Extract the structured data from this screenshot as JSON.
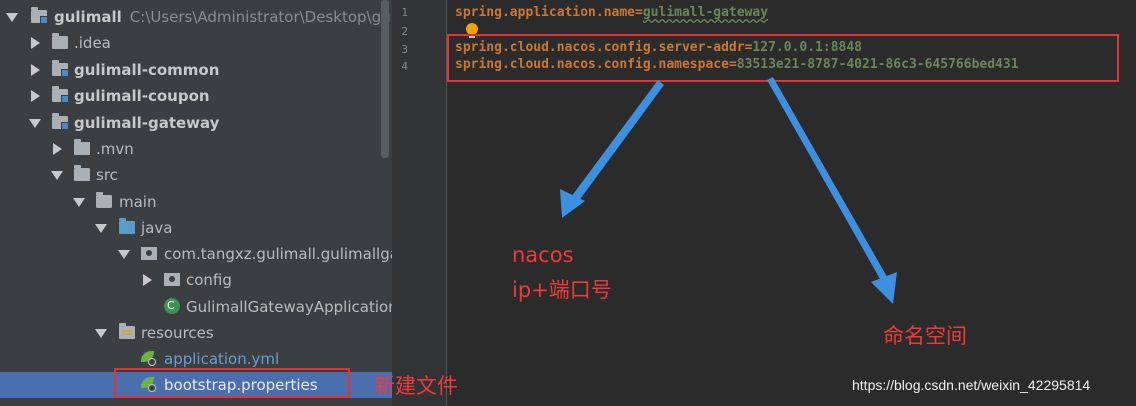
{
  "project_tree": {
    "root": {
      "name": "gulimall",
      "path": "C:\\Users\\Administrator\\Desktop\\gulim"
    },
    "items": [
      {
        "label": "gulimall"
      },
      {
        "label": ".idea"
      },
      {
        "label": "gulimall-common"
      },
      {
        "label": "gulimall-coupon"
      },
      {
        "label": "gulimall-gateway"
      },
      {
        "label": ".mvn"
      },
      {
        "label": "src"
      },
      {
        "label": "main"
      },
      {
        "label": "java"
      },
      {
        "label": "com.tangxz.gulimall.gulimallgat"
      },
      {
        "label": "config"
      },
      {
        "label": "GulimallGatewayApplication"
      },
      {
        "label": "resources"
      },
      {
        "label": "application.yml"
      },
      {
        "label": "bootstrap.properties"
      }
    ]
  },
  "editor": {
    "line_numbers": [
      "1",
      "2",
      "3",
      "4"
    ],
    "lines": [
      {
        "key": "spring.application.name",
        "eq": "=",
        "value": "gulimall-gateway"
      },
      {
        "key": "",
        "eq": "",
        "value": ""
      },
      {
        "key": "spring.cloud.nacos.config.server-addr",
        "eq": "=",
        "value": "127.0.0.1:8848"
      },
      {
        "key": "spring.cloud.nacos.config.namespace",
        "eq": "=",
        "value": "83513e21-8787-4021-86c3-645766bed431"
      }
    ]
  },
  "annotations": {
    "new_file": "新建文件",
    "nacos_line1": "nacos",
    "nacos_line2": "ip+端口号",
    "namespace": "命名空间",
    "color": "#ee3a3a"
  },
  "watermark": "https://blog.csdn.net/weixin_42295814"
}
